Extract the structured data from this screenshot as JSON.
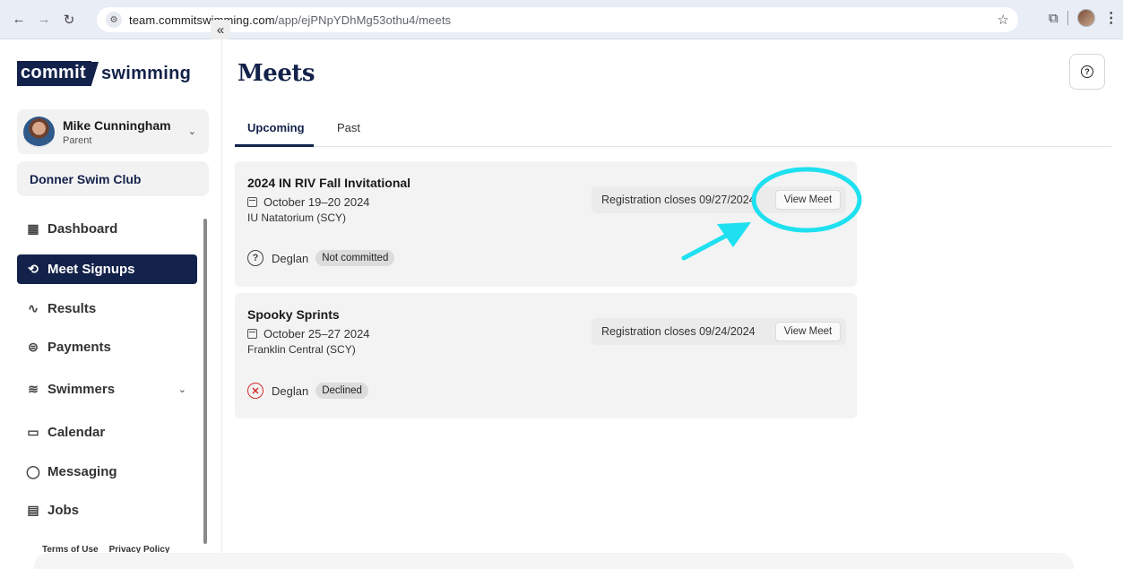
{
  "browser": {
    "url_host": "team.commitswimming.com",
    "url_path": "/app/ejPNpYDhMg53othu4/meets"
  },
  "sidebar": {
    "logo_left": "commit",
    "logo_right": "swimming",
    "collapse_label": "«",
    "user": {
      "name": "Mike Cunningham",
      "role": "Parent"
    },
    "club": "Donner Swim Club",
    "items": [
      {
        "label": "Dashboard",
        "icon": "dashboard-grid-icon"
      },
      {
        "label": "Meet Signups",
        "icon": "meet-signups-icon",
        "active": true
      },
      {
        "label": "Results",
        "icon": "results-chart-icon"
      },
      {
        "label": "Payments",
        "icon": "dollar-icon"
      },
      {
        "label": "Swimmers",
        "icon": "swimmers-icon",
        "expandable": true
      },
      {
        "label": "Calendar",
        "icon": "calendar-icon"
      },
      {
        "label": "Messaging",
        "icon": "chat-bubble-icon"
      },
      {
        "label": "Jobs",
        "icon": "clipboard-icon"
      }
    ],
    "footer": {
      "terms": "Terms of Use",
      "privacy": "Privacy Policy"
    }
  },
  "main": {
    "title": "Meets",
    "tabs": [
      {
        "label": "Upcoming",
        "active": true
      },
      {
        "label": "Past",
        "active": false
      }
    ],
    "meets": [
      {
        "name": "2024 IN RIV Fall Invitational",
        "dates": "October 19–20 2024",
        "venue": "IU Natatorium (SCY)",
        "registration": "Registration closes 09/27/2024",
        "view_label": "View Meet",
        "swimmer": "Deglan",
        "status": "Not committed",
        "status_icon": "question-circle-icon"
      },
      {
        "name": "Spooky Sprints",
        "dates": "October 25–27 2024",
        "venue": "Franklin Central (SCY)",
        "registration": "Registration closes 09/24/2024",
        "view_label": "View Meet",
        "swimmer": "Deglan",
        "status": "Declined",
        "status_icon": "x-circle-icon"
      }
    ]
  },
  "colors": {
    "brand_navy": "#13224a",
    "annotation_cyan": "#1ee0f0",
    "declined_red": "#d32f2f"
  }
}
